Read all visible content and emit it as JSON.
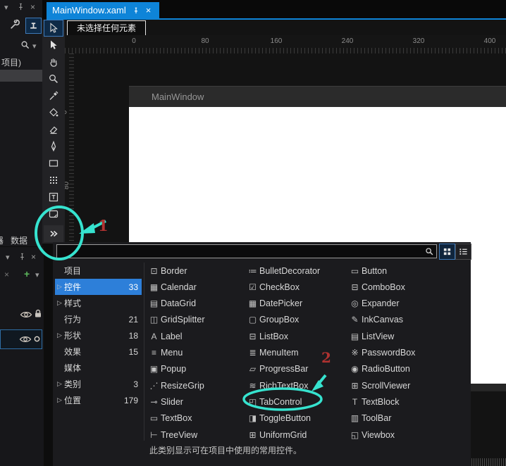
{
  "tab": {
    "title": "MainWindow.xaml"
  },
  "breadcrumb": {
    "no_selection": "未选择任何元素"
  },
  "ruler": {
    "horizontal": [
      "0",
      "80",
      "160",
      "240",
      "320",
      "400"
    ],
    "vertical": [
      "0",
      "80"
    ]
  },
  "designer": {
    "window_title": "MainWindow"
  },
  "tool_options_panel": {
    "project_label": "项目)",
    "tabs": [
      "器",
      "数据"
    ]
  },
  "toolbar": {
    "tools": [
      {
        "name": "selection",
        "icon": "cursor",
        "selected": true
      },
      {
        "name": "direct-selection",
        "icon": "cursor-solid",
        "selected": false
      },
      {
        "name": "pan",
        "icon": "hand",
        "selected": false
      },
      {
        "name": "zoom",
        "icon": "magnifier",
        "selected": false
      },
      {
        "name": "eyedropper",
        "icon": "eyedropper",
        "selected": false
      },
      {
        "name": "paint-bucket",
        "icon": "bucket",
        "selected": false
      },
      {
        "name": "eraser",
        "icon": "eraser",
        "selected": false
      },
      {
        "name": "pen",
        "icon": "pen",
        "selected": false
      },
      {
        "name": "rectangle",
        "icon": "rect",
        "selected": false
      },
      {
        "name": "grid",
        "icon": "grid",
        "selected": false
      },
      {
        "name": "text",
        "icon": "text",
        "selected": false
      },
      {
        "name": "layout",
        "icon": "layout",
        "selected": false
      },
      {
        "name": "more-tools",
        "icon": "chevron",
        "selected": false
      }
    ]
  },
  "assets_popup": {
    "categories": [
      {
        "name": "project",
        "label": "项目",
        "count": "",
        "arrow": false,
        "selected": false
      },
      {
        "name": "controls",
        "label": "控件",
        "count": "33",
        "arrow": true,
        "selected": true
      },
      {
        "name": "styles",
        "label": "样式",
        "count": "",
        "arrow": true,
        "selected": false
      },
      {
        "name": "behaviors",
        "label": "行为",
        "count": "21",
        "arrow": false,
        "selected": false
      },
      {
        "name": "shapes",
        "label": "形状",
        "count": "18",
        "arrow": true,
        "selected": false
      },
      {
        "name": "effects",
        "label": "效果",
        "count": "15",
        "arrow": false,
        "selected": false
      },
      {
        "name": "media",
        "label": "媒体",
        "count": "",
        "arrow": false,
        "selected": false
      },
      {
        "name": "categories",
        "label": "类别",
        "count": "3",
        "arrow": true,
        "selected": false
      },
      {
        "name": "locations",
        "label": "位置",
        "count": "179",
        "arrow": true,
        "selected": false
      }
    ],
    "columns": [
      [
        {
          "label": "Border",
          "glyph": "⊡"
        },
        {
          "label": "Calendar",
          "glyph": "▦"
        },
        {
          "label": "DataGrid",
          "glyph": "▤"
        },
        {
          "label": "GridSplitter",
          "glyph": "◫"
        },
        {
          "label": "Label",
          "glyph": "A"
        },
        {
          "label": "Menu",
          "glyph": "≡"
        },
        {
          "label": "Popup",
          "glyph": "▣"
        },
        {
          "label": "ResizeGrip",
          "glyph": "⋰"
        },
        {
          "label": "Slider",
          "glyph": "⊸"
        },
        {
          "label": "TextBox",
          "glyph": "▭"
        },
        {
          "label": "TreeView",
          "glyph": "⊢"
        }
      ],
      [
        {
          "label": "BulletDecorator",
          "glyph": "≔"
        },
        {
          "label": "CheckBox",
          "glyph": "☑"
        },
        {
          "label": "DatePicker",
          "glyph": "▦"
        },
        {
          "label": "GroupBox",
          "glyph": "▢"
        },
        {
          "label": "ListBox",
          "glyph": "⊟"
        },
        {
          "label": "MenuItem",
          "glyph": "≣"
        },
        {
          "label": "ProgressBar",
          "glyph": "▱"
        },
        {
          "label": "RichTextBox",
          "glyph": "≋"
        },
        {
          "label": "TabControl",
          "glyph": "◰"
        },
        {
          "label": "ToggleButton",
          "glyph": "◨"
        },
        {
          "label": "UniformGrid",
          "glyph": "⊞"
        }
      ],
      [
        {
          "label": "Button",
          "glyph": "▭"
        },
        {
          "label": "ComboBox",
          "glyph": "⊟"
        },
        {
          "label": "Expander",
          "glyph": "◎"
        },
        {
          "label": "InkCanvas",
          "glyph": "✎"
        },
        {
          "label": "ListView",
          "glyph": "▤"
        },
        {
          "label": "PasswordBox",
          "glyph": "※"
        },
        {
          "label": "RadioButton",
          "glyph": "◉"
        },
        {
          "label": "ScrollViewer",
          "glyph": "⊞"
        },
        {
          "label": "TextBlock",
          "glyph": "T"
        },
        {
          "label": "ToolBar",
          "glyph": "▥"
        },
        {
          "label": "Viewbox",
          "glyph": "◱"
        }
      ]
    ],
    "status": "此类别显示可在项目中使用的常用控件。"
  },
  "annotations": {
    "step1": "1",
    "step2": "2"
  },
  "colors": {
    "accent_blue": "#0E84D8",
    "selection_blue": "#2D7FD9",
    "annotation_cyan": "#36E3CF",
    "annotation_red": "#B03230",
    "surface_white": "#FFFFFF",
    "plus_green": "#5CB85C"
  }
}
